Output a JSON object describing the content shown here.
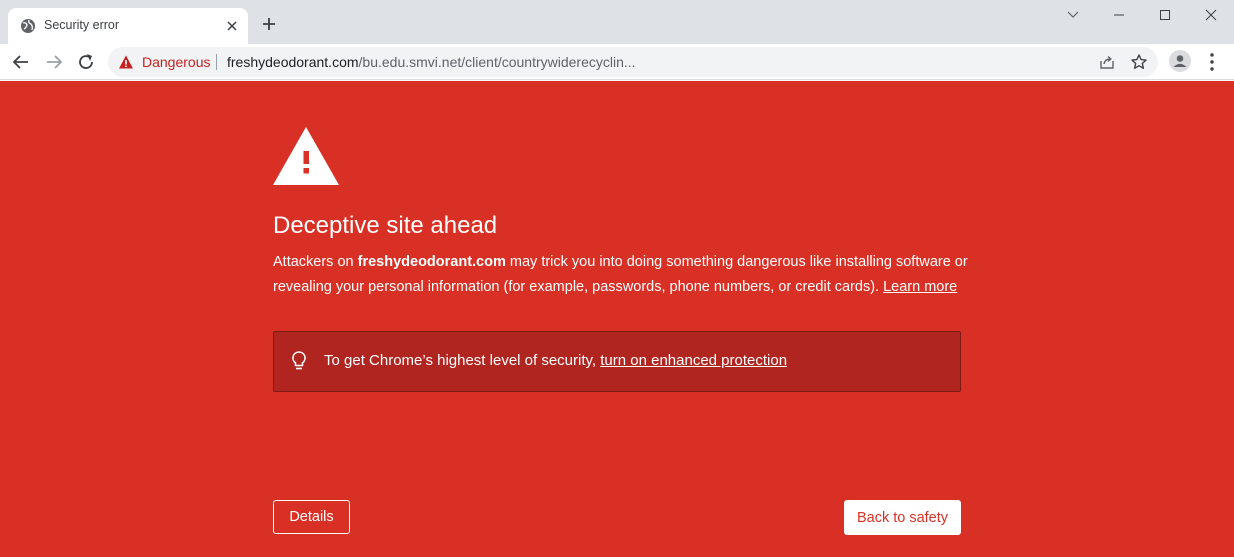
{
  "browser": {
    "tab": {
      "title": "Security error",
      "favicon": "globe-icon",
      "close_icon": "close-icon"
    },
    "new_tab_icon": "plus-icon",
    "window_controls": [
      "chevron-down-icon",
      "minimize-icon",
      "maximize-icon",
      "close-icon"
    ],
    "toolbar": {
      "back_icon": "arrow-left-icon",
      "forward_icon": "arrow-right-icon",
      "reload_icon": "reload-icon",
      "security_indicator": {
        "icon": "warning-triangle-icon",
        "label": "Dangerous",
        "color": "#c5221f"
      },
      "url_host": "freshydeodorant.com",
      "url_path": "/bu.edu.smvi.net/client/countrywiderecyclin...",
      "share_icon": "share-icon",
      "bookmark_icon": "star-icon",
      "profile_icon": "account-icon",
      "menu_icon": "more-vert-icon"
    }
  },
  "interstitial": {
    "background_color": "#d93025",
    "hero_icon": "warning-triangle-icon",
    "heading": "Deceptive site ahead",
    "body": {
      "prefix": "Attackers on ",
      "domain": "freshydeodorant.com",
      "suffix": " may trick you into doing something dangerous like installing software or revealing your personal information (for example, passwords, phone numbers, or credit cards). ",
      "learn_more": "Learn more"
    },
    "enhanced_protection": {
      "icon": "lightbulb-icon",
      "text": "To get Chrome’s highest level of security, ",
      "link": "turn on enhanced protection"
    },
    "details_button": "Details",
    "back_button": "Back to safety"
  }
}
